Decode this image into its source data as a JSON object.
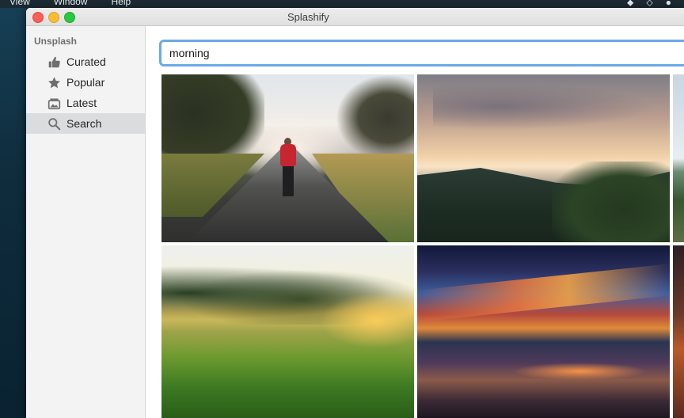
{
  "menubar": {
    "items": [
      "View",
      "Window",
      "Help"
    ]
  },
  "window": {
    "title": "Splashify"
  },
  "sidebar": {
    "heading": "Unsplash",
    "items": [
      {
        "label": "Curated",
        "icon": "thumbs-up-icon"
      },
      {
        "label": "Popular",
        "icon": "star-icon"
      },
      {
        "label": "Latest",
        "icon": "photos-icon"
      },
      {
        "label": "Search",
        "icon": "search-icon",
        "selected": true
      }
    ]
  },
  "search": {
    "value": "morning",
    "focus_color": "#6aa9e9"
  },
  "results": {
    "photos": [
      {
        "subject": "misty-road-walker"
      },
      {
        "subject": "sunset-hills"
      },
      {
        "subject": "lake-partial"
      },
      {
        "subject": "grass-sunrise"
      },
      {
        "subject": "sunset-over-water"
      },
      {
        "subject": "sunset-partial"
      }
    ]
  },
  "colors": {
    "sidebar_bg": "#f3f3f3",
    "selected_bg": "#dadcde",
    "close": "#fc5f57",
    "minimize": "#fdbc2e",
    "zoom": "#28c840"
  }
}
